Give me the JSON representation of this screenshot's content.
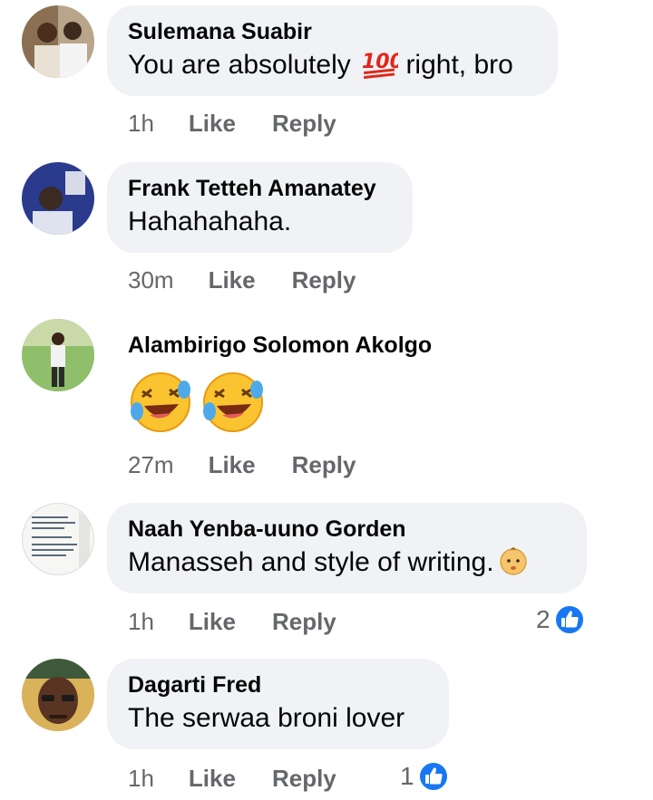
{
  "comments": [
    {
      "author": "Sulemana Suabir",
      "text": "You are absolutely",
      "emoji": "hundred-points-icon",
      "text_after": "right, bro",
      "time": "1h",
      "like_label": "Like",
      "reply_label": "Reply"
    },
    {
      "author": "Frank Tetteh Amanatey",
      "text": "Hahahahaha.",
      "time": "30m",
      "like_label": "Like",
      "reply_label": "Reply"
    },
    {
      "author": "Alambirigo Solomon Akolgo",
      "emojis": [
        "rolling-laughing-icon",
        "rolling-laughing-icon"
      ],
      "time": "27m",
      "like_label": "Like",
      "reply_label": "Reply"
    },
    {
      "author": "Naah Yenba-uuno Gorden",
      "text": "Manasseh and style of writing.",
      "emoji": "baby-face-icon",
      "time": "1h",
      "like_label": "Like",
      "reply_label": "Reply",
      "reaction_count": "2"
    },
    {
      "author": "Dagarti Fred",
      "text": "The serwaa broni lover",
      "time": "1h",
      "like_label": "Like",
      "reply_label": "Reply",
      "reaction_count": "1"
    }
  ],
  "colors": {
    "bubble": "#f0f2f5",
    "meta": "#65676b",
    "like_blue": "#1877f2"
  }
}
